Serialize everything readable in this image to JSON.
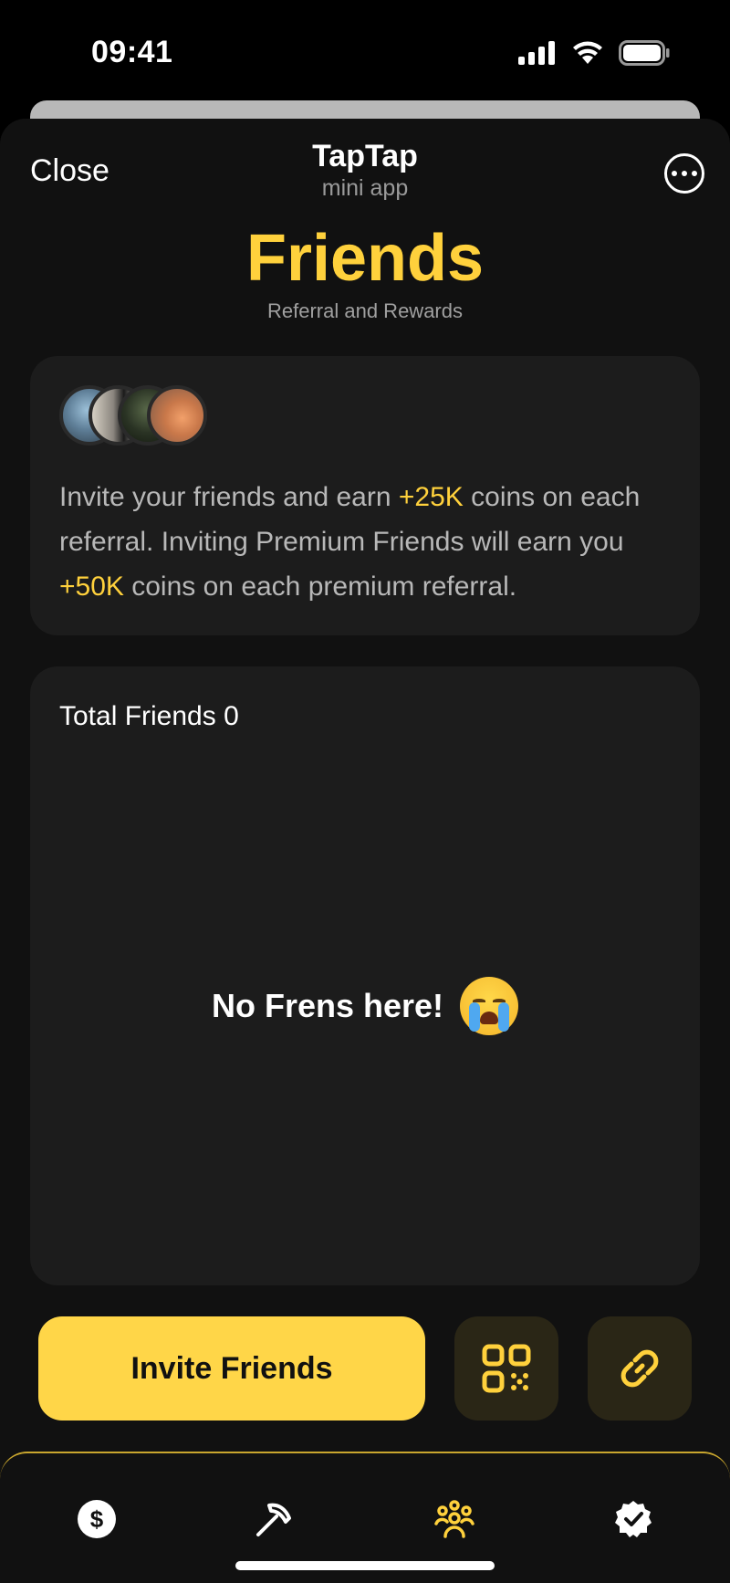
{
  "status_bar": {
    "time": "09:41",
    "icons": [
      "signal-icon",
      "wifi-icon",
      "battery-icon"
    ]
  },
  "header": {
    "close_label": "Close",
    "app_title": "TapTap",
    "app_subtitle": "mini app",
    "more_icon": "more-icon"
  },
  "page": {
    "title": "Friends",
    "subtitle": "Referral and Rewards"
  },
  "info_card": {
    "text_part1": "Invite your friends and earn ",
    "highlight1": "+25K",
    "text_part2": " coins on each referral. Inviting Premium Friends will earn you ",
    "highlight2": "+50K",
    "text_part3": " coins on each premium referral."
  },
  "friends_card": {
    "total_label": "Total Friends 0",
    "empty_text": "No Frens here!",
    "empty_icon": "crying-face-icon"
  },
  "actions": {
    "invite_label": "Invite Friends",
    "qr_icon": "qr-code-icon",
    "link_icon": "link-icon"
  },
  "bottom_nav": {
    "items": [
      {
        "icon": "dollar-coin-icon"
      },
      {
        "icon": "pickaxe-icon"
      },
      {
        "icon": "friends-icon",
        "active": true
      },
      {
        "icon": "verified-badge-icon"
      }
    ]
  },
  "colors": {
    "accent": "#ffd13c",
    "button": "#ffd648",
    "background": "#111111",
    "card": "#1c1c1c"
  }
}
